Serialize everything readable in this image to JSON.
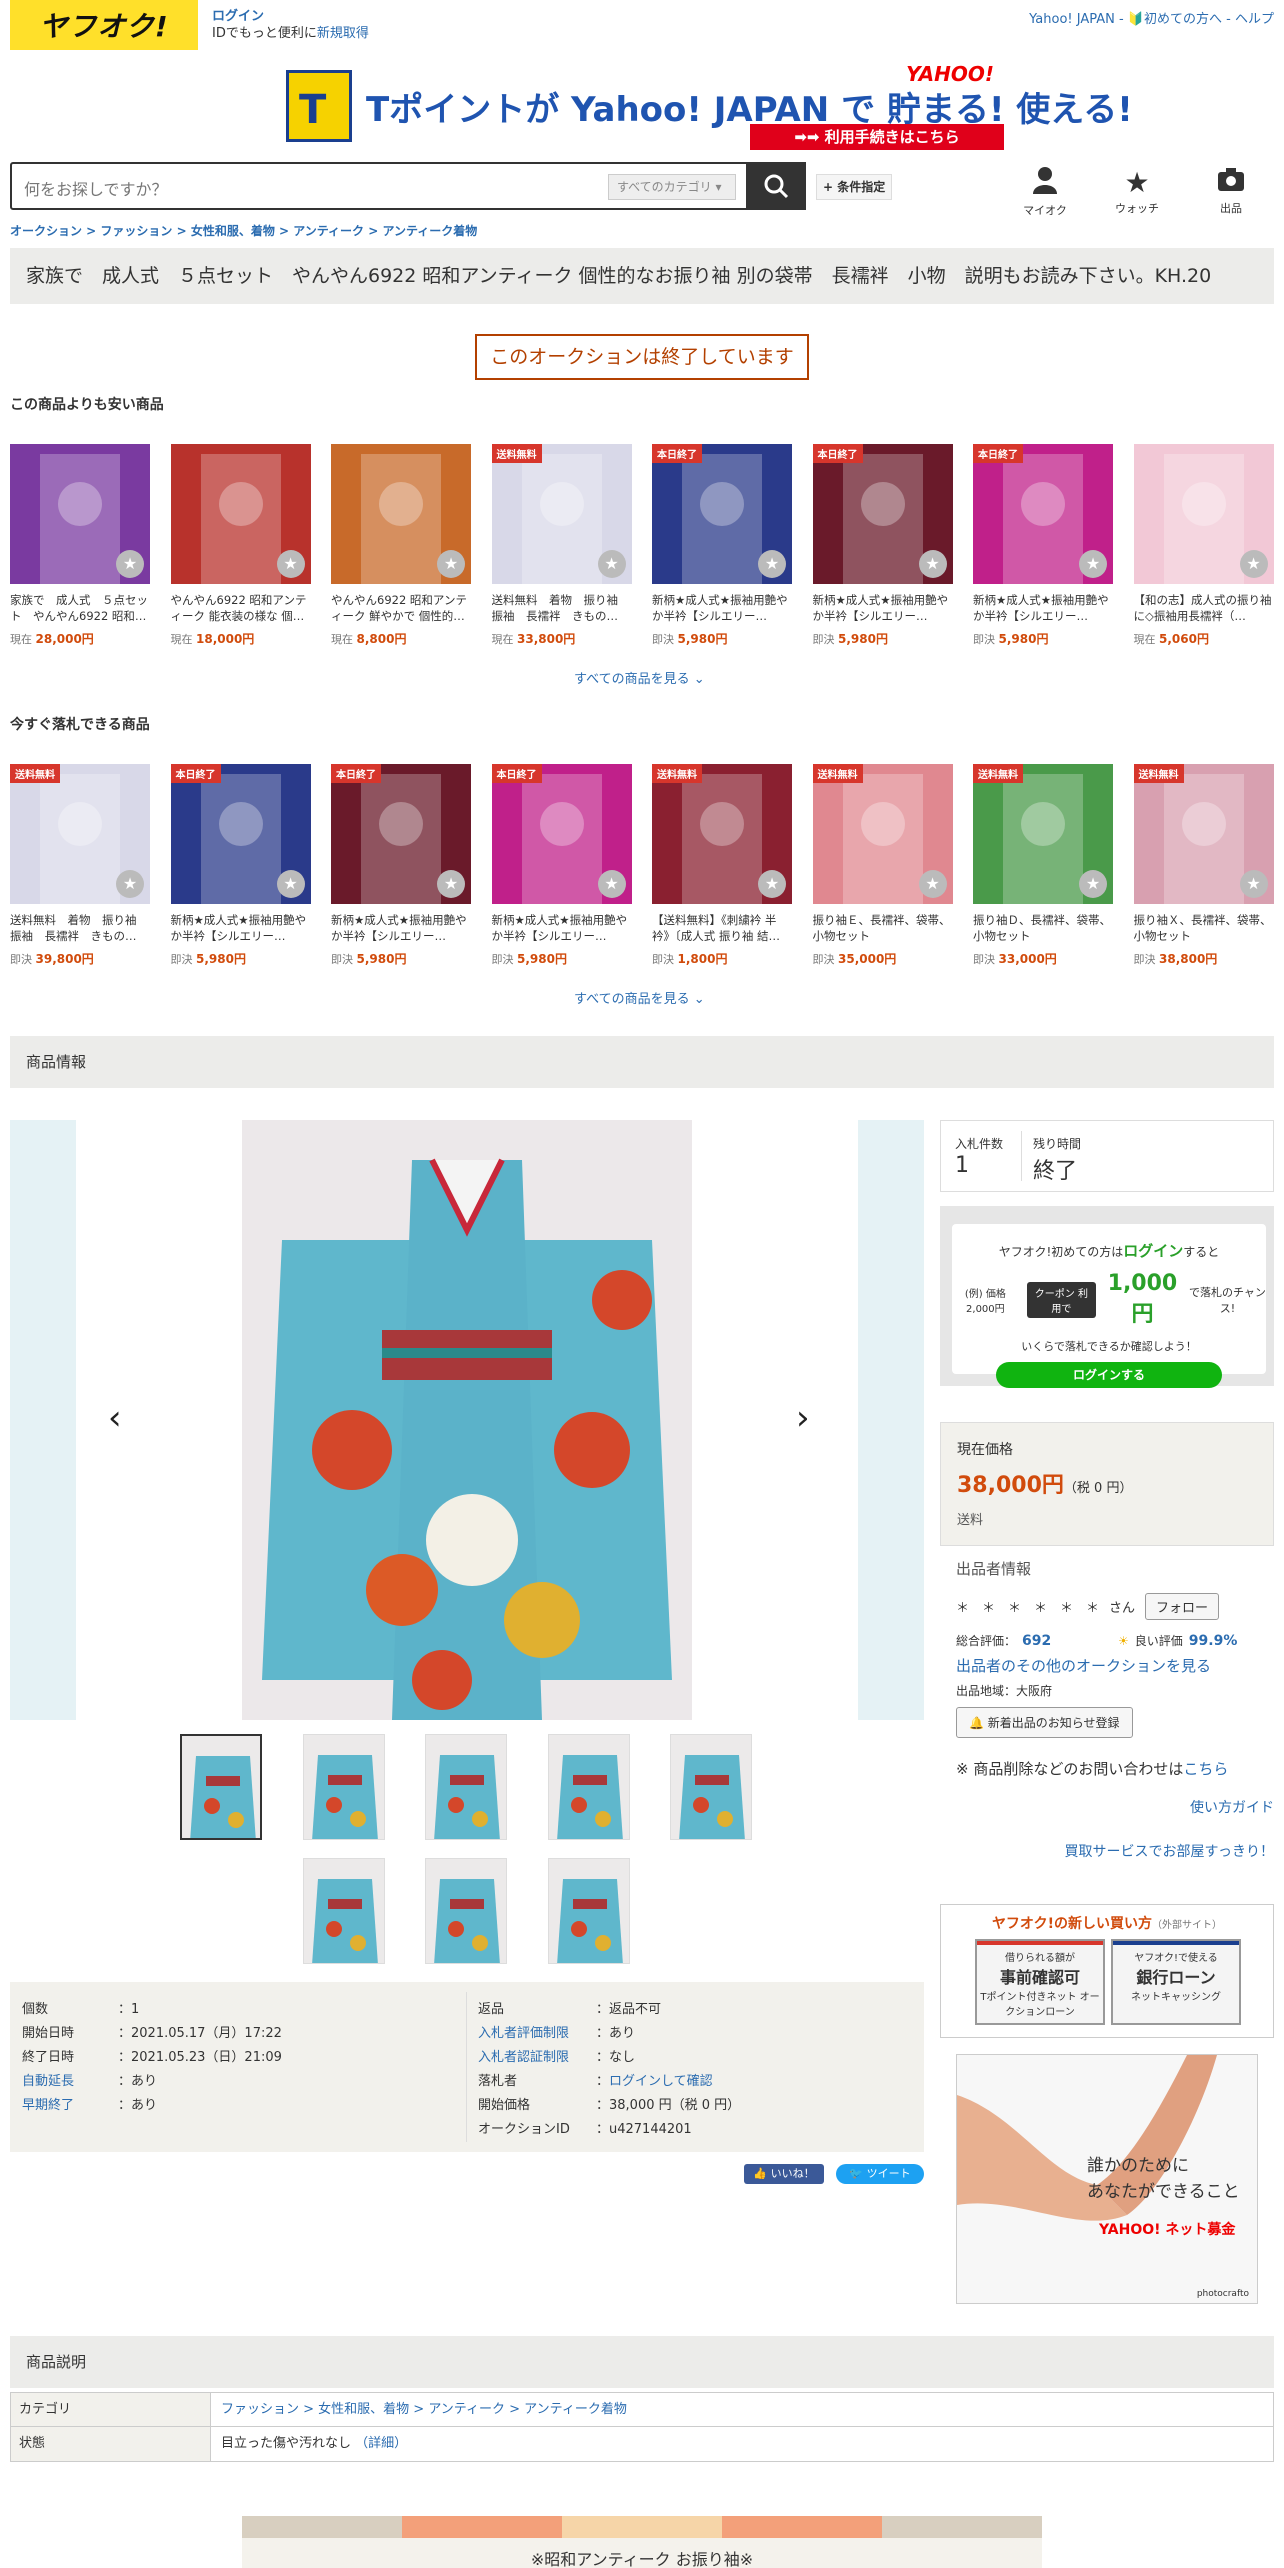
{
  "header": {
    "logo": "ヤフオク!",
    "login": "ログイン",
    "id_text": "IDでもっと便利に",
    "register": "新規取得",
    "top_links": "Yahoo! JAPAN - 🔰初めての方へ - ヘルプ"
  },
  "banner": {
    "cube": "T",
    "text": "Tポイントが Yahoo! JAPAN で 貯まる! 使える!",
    "ylogo": "YAHOO!",
    "button": "➡➡ 利用手続きはこちら"
  },
  "search": {
    "placeholder": "何をお探しですか？",
    "category": "すべてのカテゴリ",
    "cond": "+ 条件指定"
  },
  "topnav": {
    "items": [
      {
        "icon": "person-icon",
        "label": "マイオク"
      },
      {
        "icon": "star-icon",
        "label": "ウォッチ"
      },
      {
        "icon": "camera-icon",
        "label": "出品"
      }
    ]
  },
  "breadcrumb": "オークション > ファッション > 女性和服、着物 > アンティーク > アンティーク着物",
  "title": "家族で　成人式　５点セット　やんやん6922 昭和アンティーク 個性的なお振り袖 別の袋帯　長襦袢　小物　説明もお読み下さい。KH.20",
  "ended": "このオークションは終了しています",
  "cheaper": {
    "heading": "この商品よりも安い商品",
    "see_all": "すべての商品を見る",
    "items": [
      {
        "tag": "",
        "name": "家族で　成人式　５点セット　やんやん6922 昭和…",
        "label": "現在",
        "price": "28,000円",
        "color": "#7a3aa0"
      },
      {
        "tag": "",
        "name": "やんやん6922 昭和アンティーク 能衣装の様な 個…",
        "label": "現在",
        "price": "18,000円",
        "color": "#b8322c"
      },
      {
        "tag": "",
        "name": "やんやん6922 昭和アンティーク 鮮やかで 個性的…",
        "label": "現在",
        "price": "8,800円",
        "color": "#c86a2a"
      },
      {
        "tag": "送料無料",
        "name": "送料無料　着物　振り袖 振袖　長襦袢　きもの…",
        "label": "現在",
        "price": "33,800円",
        "color": "#d8d8e8"
      },
      {
        "tag": "本日終了",
        "name": "新柄★成人式★振袖用艶やか半衿【シルエリー…",
        "label": "即決",
        "price": "5,980円",
        "color": "#2a3a8a"
      },
      {
        "tag": "本日終了",
        "name": "新柄★成人式★振袖用艶やか半衿【シルエリー…",
        "label": "即決",
        "price": "5,980円",
        "color": "#6a1a2a"
      },
      {
        "tag": "本日終了",
        "name": "新柄★成人式★振袖用艶やか半衿【シルエリー…",
        "label": "即決",
        "price": "5,980円",
        "color": "#c0208a"
      },
      {
        "tag": "",
        "name": "【和の志】成人式の振り袖に◇振袖用長襦袢（…",
        "label": "現在",
        "price": "5,060円",
        "color": "#f2c8d6"
      }
    ]
  },
  "buynow": {
    "heading": "今すぐ落札できる商品",
    "see_all": "すべての商品を見る",
    "items": [
      {
        "tag": "送料無料",
        "name": "送料無料　着物　振り袖 振袖　長襦袢　きもの…",
        "label": "即決",
        "price": "39,800円",
        "color": "#d8d8e8"
      },
      {
        "tag": "本日終了",
        "name": "新柄★成人式★振袖用艶やか半衿【シルエリー…",
        "label": "即決",
        "price": "5,980円",
        "color": "#2a3a8a"
      },
      {
        "tag": "本日終了",
        "name": "新柄★成人式★振袖用艶やか半衿【シルエリー…",
        "label": "即決",
        "price": "5,980円",
        "color": "#6a1a2a"
      },
      {
        "tag": "本日終了",
        "name": "新柄★成人式★振袖用艶やか半衿【シルエリー…",
        "label": "即決",
        "price": "5,980円",
        "color": "#c0208a"
      },
      {
        "tag": "送料無料",
        "name": "【送料無料】《刺繍衿 半衿》〔成人式 振り袖 結…",
        "label": "即決",
        "price": "1,800円",
        "color": "#8a2030"
      },
      {
        "tag": "送料無料",
        "name": "振り袖Ｅ、長襦袢、袋帯、小物セット",
        "label": "即決",
        "price": "35,000円",
        "color": "#e08890"
      },
      {
        "tag": "送料無料",
        "name": "振り袖Ｄ、長襦袢、袋帯、小物セット",
        "label": "即決",
        "price": "33,000円",
        "color": "#4a9a4a"
      },
      {
        "tag": "送料無料",
        "name": "振り袖Ｘ、長襦袢、袋帯、小物セット",
        "label": "即決",
        "price": "38,800円",
        "color": "#d8a0b0"
      }
    ]
  },
  "product_info_heading": "商品情報",
  "bid": {
    "count_label": "入札件数",
    "count": "1",
    "time_label": "残り時間",
    "time": "終了"
  },
  "promo": {
    "line1a": "ヤフオク!初めての方は",
    "line1b": "ログイン",
    "line1c": "すると",
    "example": "(例) 価格2,000円",
    "coupon": "クーポン 利用で",
    "amount": "1,000円",
    "amount_sub": "で落札のチャンス!",
    "check": "いくらで落札できるか確認しよう！",
    "button": "ログインする"
  },
  "price": {
    "label": "現在価格",
    "value": "38,000円",
    "tax": "（税 0 円）",
    "shipping": "送料"
  },
  "seller": {
    "heading": "出品者情報",
    "name": "＊　＊　＊　＊　＊　＊",
    "san": "さん",
    "follow": "フォロー",
    "rating_label": "総合評価：",
    "rating": "692",
    "good_label": "良い評価",
    "good": "99.9%",
    "other": "出品者のその他のオークションを見る",
    "region": "出品地域：大阪府",
    "notify": "新着出品のお知らせ登録"
  },
  "inquiry": {
    "text": "※ 商品削除などのお問い合わせは",
    "link": "こちら"
  },
  "guide": "使い方ガイド",
  "support": "買取サービスでお部屋すっきり！",
  "newbuy": {
    "heading": "ヤフオク!の新しい買い方",
    "external": "（外部サイト）",
    "b1_sub": "借りられる額が",
    "b1": "事前確認可",
    "b1_small": "Tポイント付きネット オークションローン",
    "b2_sub": "ヤフオク!で使える",
    "b2": "銀行ローン",
    "b2_small": "ネットキャッシング"
  },
  "ad": {
    "line1": "誰かのために",
    "line2": "あなたができること",
    "brand": "YAHOO! ネット募金",
    "credit": "photocrafto"
  },
  "details": {
    "left": [
      {
        "k": "個数",
        "v": "：1",
        "link": false
      },
      {
        "k": "開始日時",
        "v": "：2021.05.17（月）17:22",
        "link": false
      },
      {
        "k": "終了日時",
        "v": "：2021.05.23（日）21:09",
        "link": false
      },
      {
        "k": "自動延長",
        "v": "：あり",
        "link": true
      },
      {
        "k": "早期終了",
        "v": "：あり",
        "link": true
      }
    ],
    "right": [
      {
        "k": "返品",
        "v": "：返品不可",
        "link": false
      },
      {
        "k": "入札者評価制限",
        "v": "：あり",
        "link": true
      },
      {
        "k": "入札者認証制限",
        "v": "：なし",
        "link": true
      },
      {
        "k": "落札者",
        "v": "：",
        "vlink": "ログインして確認",
        "link": false
      },
      {
        "k": "開始価格",
        "v": "：38,000 円（税 0 円）",
        "link": false
      },
      {
        "k": "オークションID",
        "v": "：u427144201",
        "link": false
      }
    ]
  },
  "social": {
    "like": "いいね！",
    "tweet": "ツイート"
  },
  "description_heading": "商品説明",
  "category_table": {
    "k1": "カテゴリ",
    "v1": "ファッション > 女性和服、着物 > アンティーク > アンティーク着物",
    "k2": "状態",
    "v2": "目立った傷や汚れなし",
    "v2_link": "（詳細）"
  },
  "footer_heading": "※昭和アンティーク お振り袖※"
}
